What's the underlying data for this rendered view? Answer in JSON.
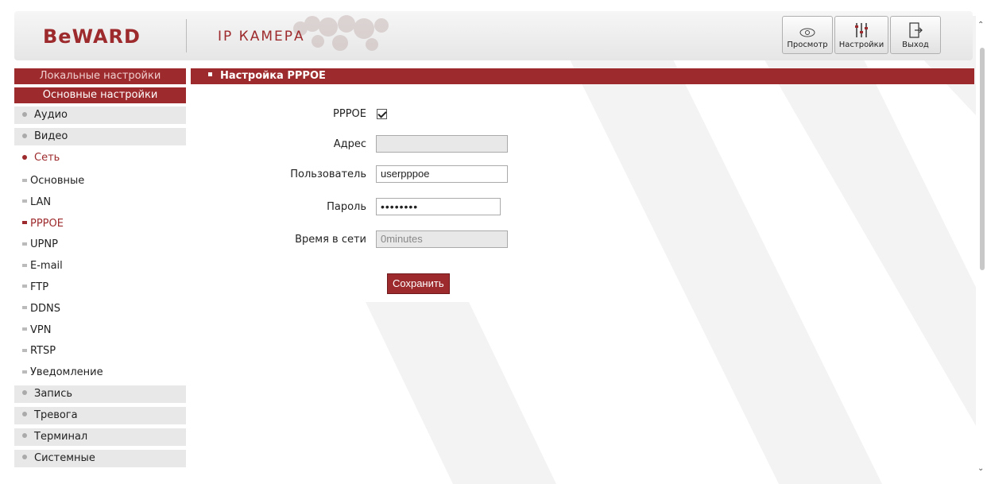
{
  "header": {
    "logo": "BeWARD",
    "subtitle": "IP КАМЕРА",
    "buttons": {
      "view": "Просмотр",
      "settings": "Настройки",
      "exit": "Выход"
    }
  },
  "sidebar": {
    "local_settings": "Локальные настройки",
    "basic_settings": "Основные настройки",
    "items": {
      "audio": "Аудио",
      "video": "Видео",
      "network": "Сеть",
      "record": "Запись",
      "alarm": "Тревога",
      "terminal": "Терминал",
      "system": "Системные"
    },
    "network_sub": [
      "Основные",
      "LAN",
      "PPPOE",
      "UPNP",
      "E-mail",
      "FTP",
      "DDNS",
      "VPN",
      "RTSP",
      "Уведомление"
    ]
  },
  "main": {
    "section_title": "Настройка PPPOE",
    "form": {
      "pppoe_label": "PPPOE",
      "pppoe_checked": true,
      "address_label": "Адрес",
      "address_value": "",
      "user_label": "Пользователь",
      "user_value": "userpppoe",
      "password_label": "Пароль",
      "password_value": "••••••••",
      "online_time_label": "Время в сети",
      "online_time_value": "0minutes",
      "save_button": "Сохранить"
    }
  },
  "colors": {
    "accent": "#9d2a2c",
    "sidebar_item_bg": "#e8e8e8",
    "header_bg": "#eeeeee"
  }
}
